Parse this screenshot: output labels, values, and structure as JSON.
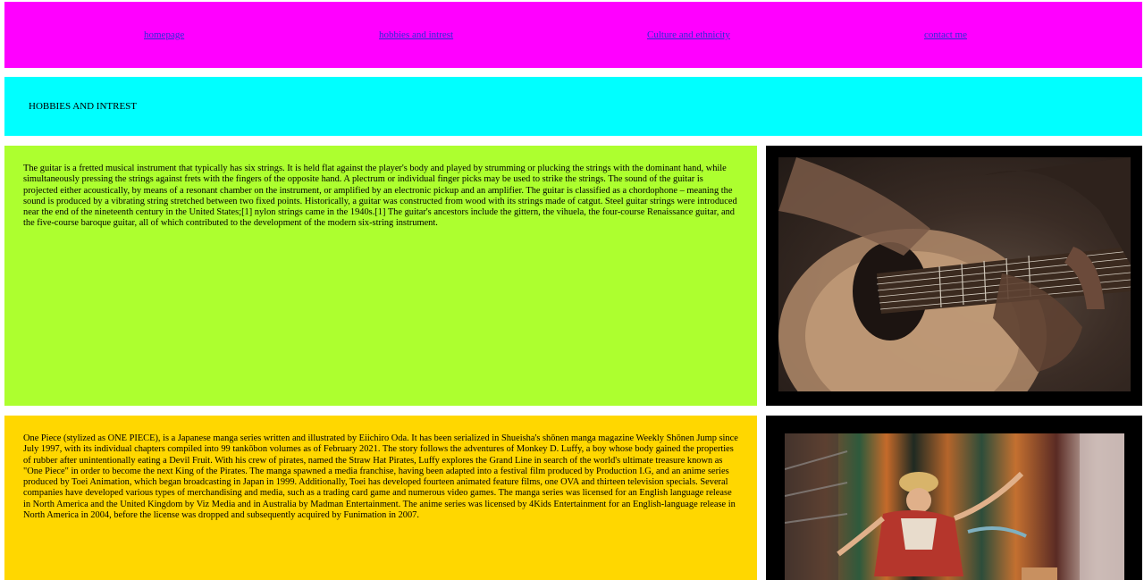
{
  "nav": {
    "links": [
      "homepage",
      "hobbies and intrest",
      "Culture and ethnicity",
      "contact me"
    ]
  },
  "header": {
    "title": "HOBBIES AND INTREST"
  },
  "sections": [
    {
      "text": "The guitar is a fretted musical instrument that typically has six strings. It is held flat against the player's body and played by strumming or plucking the strings with the dominant hand, while simultaneously pressing the strings against frets with the fingers of the opposite hand. A plectrum or individual finger picks may be used to strike the strings. The sound of the guitar is projected either acoustically, by means of a resonant chamber on the instrument, or amplified by an electronic pickup and an amplifier. The guitar is classified as a chordophone – meaning the sound is produced by a vibrating string stretched between two fixed points. Historically, a guitar was constructed from wood with its strings made of catgut. Steel guitar strings were introduced near the end of the nineteenth century in the United States;[1] nylon strings came in the 1940s.[1] The guitar's ancestors include the gittern, the vihuela, the four-course Renaissance guitar, and the five-course baroque guitar, all of which contributed to the development of the modern six-string instrument.",
      "bg_color": "#adff2f"
    },
    {
      "text": "One Piece (stylized as ONE PIECE), is a Japanese manga series written and illustrated by Eiichiro Oda. It has been serialized in Shueisha's shōnen manga magazine Weekly Shōnen Jump since July 1997, with its individual chapters compiled into 99 tankōbon volumes as of February 2021. The story follows the adventures of Monkey D. Luffy, a boy whose body gained the properties of rubber after unintentionally eating a Devil Fruit. With his crew of pirates, named the Straw Hat Pirates, Luffy explores the Grand Line in search of the world's ultimate treasure known as \"One Piece\" in order to become the next King of the Pirates. The manga spawned a media franchise, having been adapted into a festival film produced by Production I.G, and an anime series produced by Toei Animation, which began broadcasting in Japan in 1999. Additionally, Toei has developed fourteen animated feature films, one OVA and thirteen television specials. Several companies have developed various types of merchandising and media, such as a trading card game and numerous video games. The manga series was licensed for an English language release in North America and the United Kingdom by Viz Media and in Australia by Madman Entertainment. The anime series was licensed by 4Kids Entertainment for an English-language release in North America in 2004, before the license was dropped and subsequently acquired by Funimation in 2007.",
      "bg_color": "#ffd700"
    }
  ],
  "colors": {
    "nav_bg": "#ff00ff",
    "header_bg": "#00ffff",
    "image_frame": "#000000",
    "link": "#2b2bd6"
  }
}
